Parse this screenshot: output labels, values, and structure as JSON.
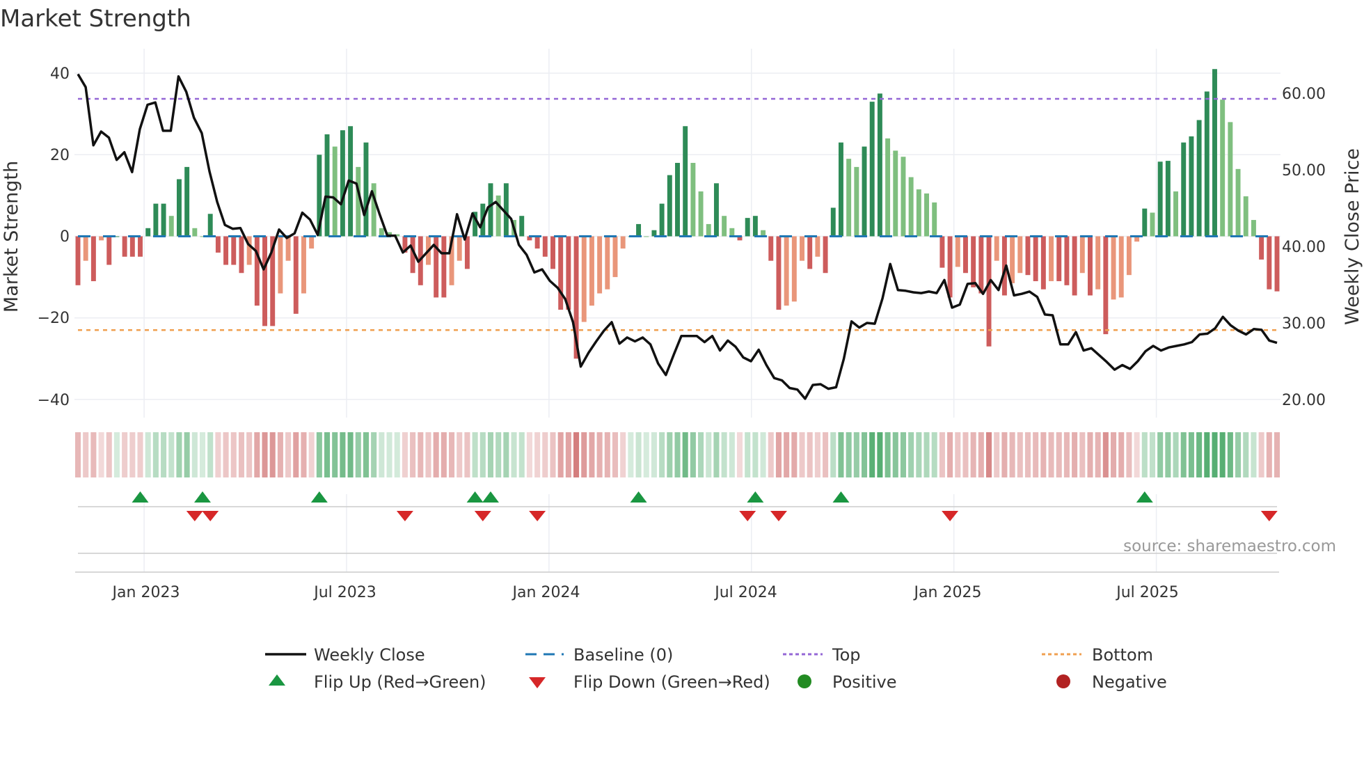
{
  "title": "Market Strength",
  "source": "source: sharemaestro.com",
  "colors": {
    "pos_strong": "#2e8b57",
    "pos_weak": "#7fbf7f",
    "neg_strong": "#cd5c5c",
    "neg_weak": "#e9967a",
    "baseline": "#1f77b4",
    "top": "#9467d6",
    "bottom": "#f0a050",
    "close": "#111111",
    "flip_up": "#1a9641",
    "flip_down": "#d62728"
  },
  "chart_data": {
    "type": "bar",
    "title": "Market Strength",
    "ylabel": "Market Strength",
    "y2label": "Weekly Close Price",
    "ylim": [
      -44,
      44
    ],
    "y2lim": [
      19,
      65
    ],
    "y_ticks": [
      "40",
      "20",
      "0",
      "−20",
      "−40"
    ],
    "y_tick_values": [
      40,
      20,
      0,
      -20,
      -40
    ],
    "y2_ticks": [
      "60.00",
      "50.00",
      "40.00",
      "30.00",
      "20.00"
    ],
    "y2_tick_values": [
      60,
      50,
      40,
      30,
      20
    ],
    "x_ticks": [
      "Jan 2023",
      "Jul 2023",
      "Jan 2024",
      "Jul 2024",
      "Jan 2025",
      "Jul 2025"
    ],
    "x_tick_week_index": [
      8.5,
      34.5,
      60.5,
      86.5,
      112.5,
      138.5
    ],
    "top_level": 33.7,
    "bottom_level": -23,
    "strength": [
      -12,
      -6,
      -11,
      -1,
      -7,
      0,
      -5,
      -5,
      -5,
      2,
      8,
      8,
      5,
      14,
      17,
      2,
      0,
      5.5,
      -4,
      -7,
      -7,
      -9,
      -7,
      -17,
      -22,
      -22,
      -14,
      -6,
      -19,
      -14,
      -3,
      20,
      25,
      22,
      26,
      27,
      17,
      23,
      13,
      2,
      1,
      0.5,
      -4,
      -9,
      -12,
      -7,
      -15,
      -15,
      -12,
      -6,
      -8,
      6,
      8,
      13,
      10,
      13,
      4,
      5,
      -1,
      -3,
      -5,
      -8,
      -18,
      -18,
      -30,
      -21,
      -17,
      -14,
      -13,
      -10,
      -3,
      0,
      3,
      0,
      1.5,
      8,
      15,
      18,
      27,
      18,
      11,
      3,
      13,
      5,
      2,
      -1,
      4.5,
      5,
      1.5,
      -6,
      -18,
      -17,
      -16,
      -6,
      -8,
      -5,
      -9,
      7,
      23,
      19,
      17,
      22,
      33,
      35,
      24,
      21,
      19.5,
      14.5,
      11.5,
      10.5,
      8.3,
      -7.7,
      -15,
      -7.5,
      -9,
      -12.5,
      -14,
      -27,
      -6,
      -14.5,
      -11.5,
      -9,
      -9.5,
      -11,
      -13,
      -11,
      -11,
      -12,
      -14.5,
      -9,
      -14.5,
      -13,
      -24,
      -15.5,
      -15,
      -9.5,
      -1.3,
      6.8,
      5.8,
      18.3,
      18.5,
      11,
      23,
      24.5,
      28.5,
      35.5,
      41,
      33.5,
      28,
      16.5,
      9.8,
      4,
      -5.7,
      -13,
      -13.5
    ],
    "weekly_close": [
      62.5,
      60.8,
      53.2,
      55,
      54.2,
      51.3,
      52.3,
      49.7,
      55.3,
      58.5,
      58.8,
      55.1,
      55.1,
      62.2,
      60.2,
      56.8,
      54.8,
      49.8,
      45.8,
      42.8,
      42.3,
      42.4,
      40.3,
      39.4,
      37,
      39.2,
      42.2,
      41.1,
      41.7,
      44.4,
      43.5,
      41.5,
      46.5,
      46.4,
      45.5,
      48.6,
      48.2,
      44.1,
      47.2,
      44.2,
      41.4,
      41.4,
      39.2,
      40.1,
      38,
      39.1,
      40.2,
      39.1,
      39.1,
      44.2,
      40.9,
      44.3,
      42.5,
      45.1,
      45.8,
      44.7,
      43.6,
      40.2,
      38.9,
      36.6,
      37,
      35.5,
      34.6,
      33.1,
      30.1,
      24.3,
      26.1,
      27.6,
      29,
      30.1,
      27.3,
      28.1,
      27.6,
      28.1,
      27.2,
      24.7,
      23.2,
      25.8,
      28.3,
      28.3,
      28.3,
      27.5,
      28.3,
      26.4,
      27.7,
      26.9,
      25.5,
      25,
      26.5,
      24.5,
      22.8,
      22.5,
      21.5,
      21.3,
      20.1,
      21.9,
      22,
      21.4,
      21.6,
      25.3,
      30.2,
      29.4,
      30,
      29.9,
      33.2,
      37.7,
      34.3,
      34.2,
      34,
      33.9,
      34.1,
      33.9,
      35.6,
      32,
      32.4,
      35.1,
      35.2,
      33.8,
      35.6,
      34.3,
      37.5,
      33.6,
      33.8,
      34.1,
      33.4,
      31.1,
      31,
      27.2,
      27.2,
      28.8,
      26.4,
      26.7,
      25.8,
      24.9,
      23.9,
      24.5,
      24,
      25,
      26.3,
      27,
      26.4,
      26.8,
      27,
      27.2,
      27.5,
      28.5,
      28.6,
      29.3,
      30.8,
      29.7,
      29,
      28.5,
      29.2,
      29.1,
      27.7,
      27.4
    ],
    "flip_up_week_index": [
      8,
      16,
      31,
      51,
      53,
      72,
      87,
      98,
      137
    ],
    "flip_down_week_index": [
      15,
      17,
      42,
      52,
      59,
      86,
      90,
      112,
      153
    ],
    "legend": {
      "placement": "bottom",
      "entries": [
        "Weekly Close",
        "Baseline (0)",
        "Top",
        "Bottom",
        "Flip Up (Red→Green)",
        "Flip Down (Green→Red)",
        "Positive",
        "Negative"
      ]
    }
  }
}
